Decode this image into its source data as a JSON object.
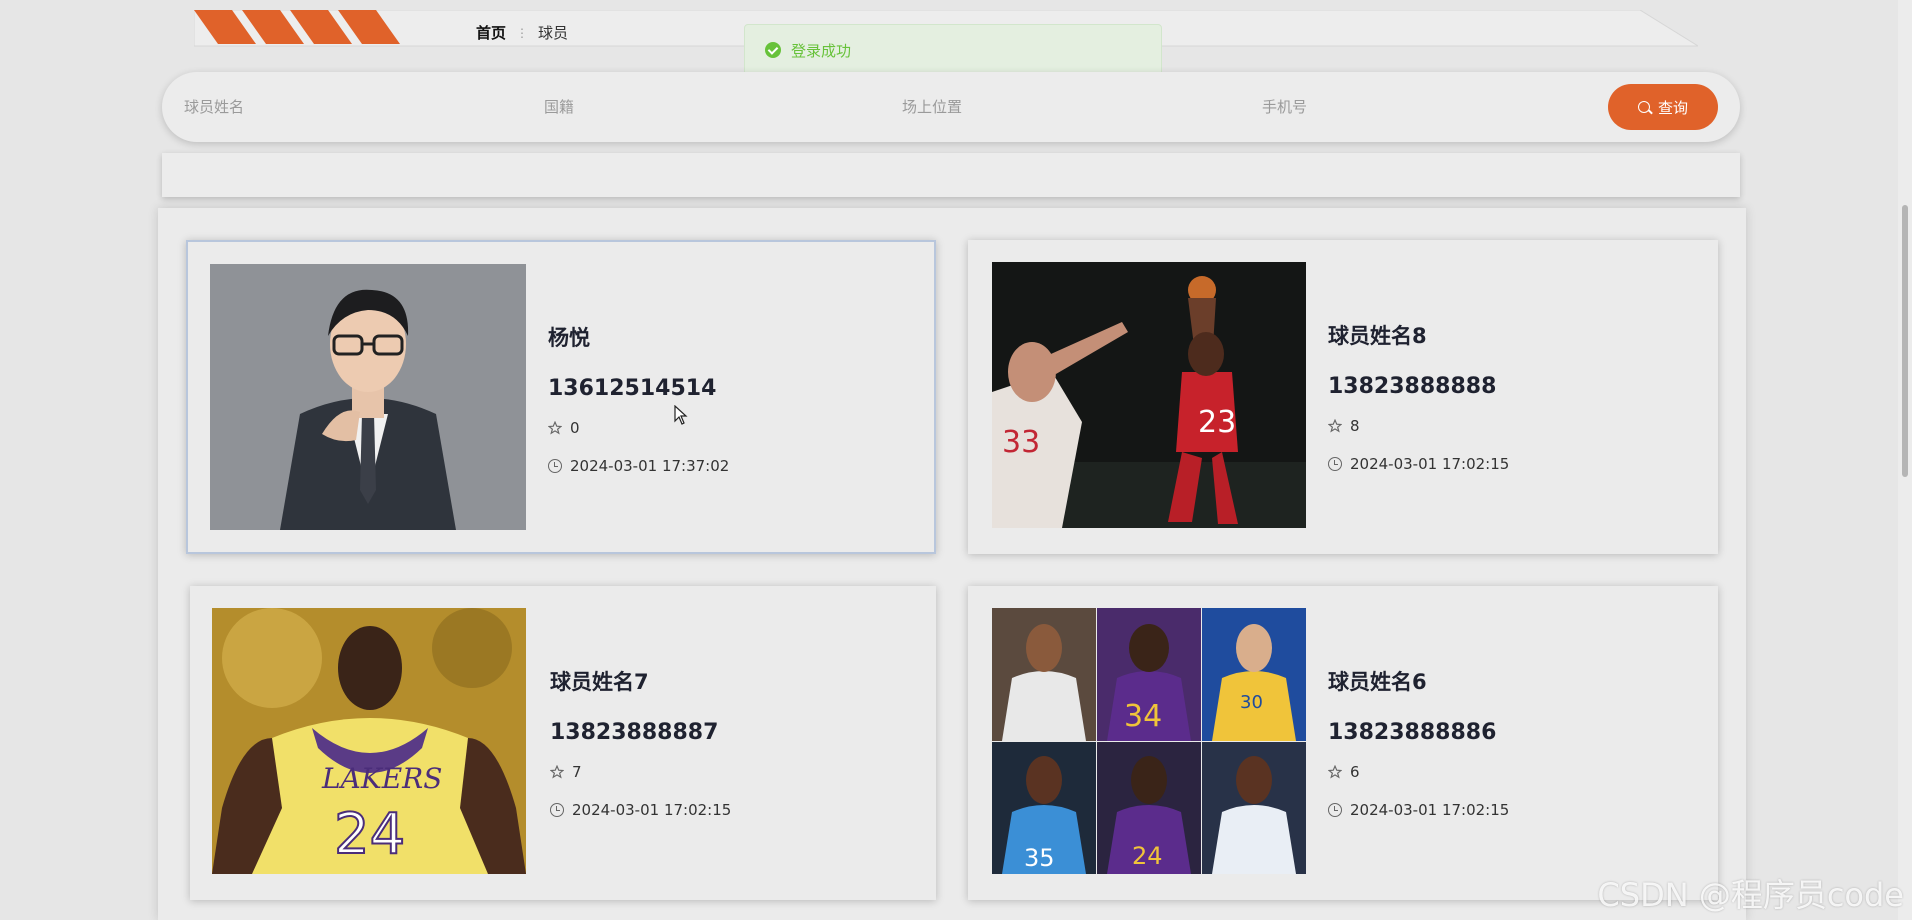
{
  "breadcrumb": {
    "home": "首页",
    "separator": "⋮",
    "current": "球员"
  },
  "toast": {
    "message": "登录成功",
    "icon": "check-circle-icon",
    "color": "#67c23a"
  },
  "search": {
    "name_placeholder": "球员姓名",
    "nationality_placeholder": "国籍",
    "position_placeholder": "场上位置",
    "phone_placeholder": "手机号",
    "button_label": "查询",
    "accent": "#e0622a"
  },
  "players": [
    {
      "name": "杨悦",
      "phone": "13612514514",
      "likes": "0",
      "time": "2024-03-01 17:37:02",
      "photo": "man-in-suit-portrait"
    },
    {
      "name": "球员姓名8",
      "phone": "13823888888",
      "likes": "8",
      "time": "2024-03-01 17:02:15",
      "photo": "basketball-jump-shot"
    },
    {
      "name": "球员姓名7",
      "phone": "13823888887",
      "likes": "7",
      "time": "2024-03-01 17:02:15",
      "photo": "lakers-24-player"
    },
    {
      "name": "球员姓名6",
      "phone": "13823888886",
      "likes": "6",
      "time": "2024-03-01 17:02:15",
      "photo": "basketball-players-collage"
    }
  ],
  "watermark": "CSDN @程序员code"
}
